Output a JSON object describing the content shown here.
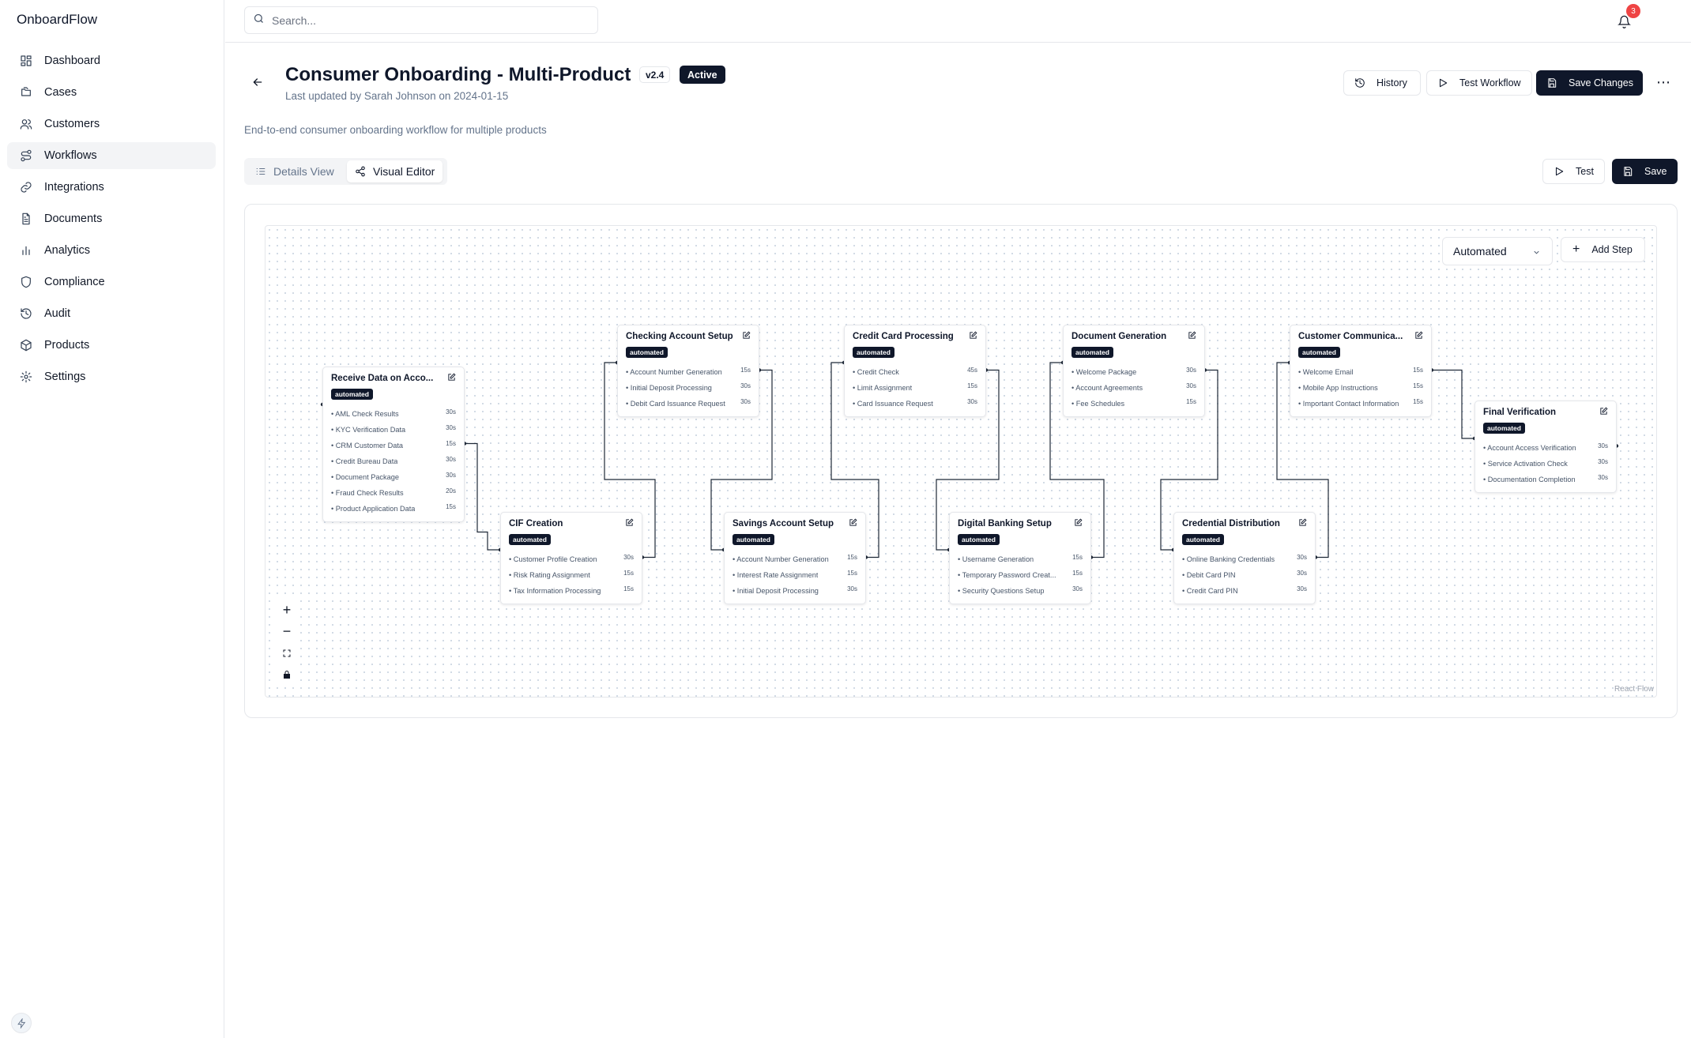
{
  "app": {
    "brand": "OnboardFlow"
  },
  "sidebar": {
    "items": [
      {
        "label": "Dashboard",
        "icon": "layout-grid-icon"
      },
      {
        "label": "Cases",
        "icon": "folders-icon"
      },
      {
        "label": "Customers",
        "icon": "users-icon"
      },
      {
        "label": "Workflows",
        "icon": "route-icon",
        "active": true
      },
      {
        "label": "Integrations",
        "icon": "link-icon"
      },
      {
        "label": "Documents",
        "icon": "file-text-icon"
      },
      {
        "label": "Analytics",
        "icon": "bar-chart-icon"
      },
      {
        "label": "Compliance",
        "icon": "shield-icon"
      },
      {
        "label": "Audit",
        "icon": "history-icon"
      },
      {
        "label": "Products",
        "icon": "package-icon"
      },
      {
        "label": "Settings",
        "icon": "gear-icon"
      }
    ]
  },
  "topbar": {
    "search_placeholder": "Search...",
    "notification_count": "3"
  },
  "workflow": {
    "title": "Consumer Onboarding - Multi-Product",
    "version": "v2.4",
    "status": "Active",
    "updated": "Last updated by Sarah Johnson on 2024-01-15",
    "description": "End-to-end consumer onboarding workflow for multiple products"
  },
  "actions": {
    "history": "History",
    "test_workflow": "Test Workflow",
    "save_changes": "Save Changes"
  },
  "tabs": {
    "details": "Details View",
    "visual": "Visual Editor"
  },
  "editor_actions": {
    "test": "Test",
    "save": "Save"
  },
  "canvas": {
    "mode": "Automated",
    "add_step": "Add Step",
    "attribution": "React Flow"
  },
  "colors": {
    "primary": "#0f172a",
    "notification": "#ef4444",
    "muted_text": "#64748b"
  },
  "nodes": [
    {
      "title": "Receive Data on Acco...",
      "badge": "automated",
      "items": [
        {
          "name": "• AML Check Results",
          "time": "30s"
        },
        {
          "name": "• KYC Verification Data",
          "time": "30s"
        },
        {
          "name": "• CRM Customer Data",
          "time": "15s"
        },
        {
          "name": "• Credit Bureau Data",
          "time": "30s"
        },
        {
          "name": "• Document Package",
          "time": "30s"
        },
        {
          "name": "• Fraud Check Results",
          "time": "20s"
        },
        {
          "name": "• Product Application Data",
          "time": "15s"
        }
      ]
    },
    {
      "title": "CIF Creation",
      "badge": "automated",
      "items": [
        {
          "name": "• Customer Profile Creation",
          "time": "30s"
        },
        {
          "name": "• Risk Rating Assignment",
          "time": "15s"
        },
        {
          "name": "• Tax Information Processing",
          "time": "15s"
        }
      ]
    },
    {
      "title": "Checking Account Setup",
      "badge": "automated",
      "items": [
        {
          "name": "• Account Number Generation",
          "time": "15s"
        },
        {
          "name": "• Initial Deposit Processing",
          "time": "30s"
        },
        {
          "name": "• Debit Card Issuance Request",
          "time": "30s"
        }
      ]
    },
    {
      "title": "Savings Account Setup",
      "badge": "automated",
      "items": [
        {
          "name": "• Account Number Generation",
          "time": "15s"
        },
        {
          "name": "• Interest Rate Assignment",
          "time": "15s"
        },
        {
          "name": "• Initial Deposit Processing",
          "time": "30s"
        }
      ]
    },
    {
      "title": "Credit Card Processing",
      "badge": "automated",
      "items": [
        {
          "name": "• Credit Check",
          "time": "45s"
        },
        {
          "name": "• Limit Assignment",
          "time": "15s"
        },
        {
          "name": "• Card Issuance Request",
          "time": "30s"
        }
      ]
    },
    {
      "title": "Digital Banking Setup",
      "badge": "automated",
      "items": [
        {
          "name": "• Username Generation",
          "time": "15s"
        },
        {
          "name": "• Temporary Password Creat...",
          "time": "15s"
        },
        {
          "name": "• Security Questions Setup",
          "time": "30s"
        }
      ]
    },
    {
      "title": "Document Generation",
      "badge": "automated",
      "items": [
        {
          "name": "• Welcome Package",
          "time": "30s"
        },
        {
          "name": "• Account Agreements",
          "time": "30s"
        },
        {
          "name": "• Fee Schedules",
          "time": "15s"
        }
      ]
    },
    {
      "title": "Credential Distribution",
      "badge": "automated",
      "items": [
        {
          "name": "• Online Banking Credentials",
          "time": "30s"
        },
        {
          "name": "• Debit Card PIN",
          "time": "30s"
        },
        {
          "name": "• Credit Card PIN",
          "time": "30s"
        }
      ]
    },
    {
      "title": "Customer Communica...",
      "badge": "automated",
      "items": [
        {
          "name": "• Welcome Email",
          "time": "15s"
        },
        {
          "name": "• Mobile App Instructions",
          "time": "15s"
        },
        {
          "name": "• Important Contact Information",
          "time": "15s"
        }
      ]
    },
    {
      "title": "Final Verification",
      "badge": "automated",
      "items": [
        {
          "name": "• Account Access Verification",
          "time": "30s"
        },
        {
          "name": "• Service Activation Check",
          "time": "30s"
        },
        {
          "name": "• Documentation Completion",
          "time": "30s"
        }
      ]
    }
  ]
}
